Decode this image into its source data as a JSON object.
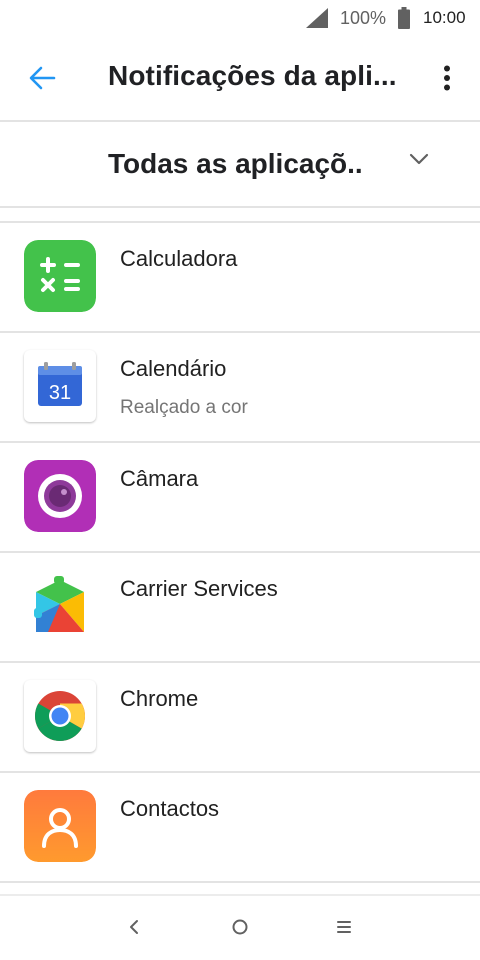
{
  "status_bar": {
    "battery_percent": "100%",
    "time": "10:00",
    "signal_icon": "cellular-signal-icon",
    "battery_icon": "battery-full-icon"
  },
  "app_bar": {
    "title": "Notificações da apli...",
    "back_icon": "arrow-back-icon",
    "menu_icon": "more-vert-icon",
    "accent_color": "#2196f3"
  },
  "filter": {
    "selected": "Todas as aplicaçõ..",
    "dropdown_icon": "chevron-down-icon"
  },
  "apps": [
    {
      "name": "Calculadora",
      "subtitle": "",
      "icon": "calculator-icon"
    },
    {
      "name": "Calendário",
      "subtitle": "Realçado a cor",
      "icon": "calendar-icon"
    },
    {
      "name": "Câmara",
      "subtitle": "",
      "icon": "camera-icon"
    },
    {
      "name": "Carrier Services",
      "subtitle": "",
      "icon": "carrier-services-icon"
    },
    {
      "name": "Chrome",
      "subtitle": "",
      "icon": "chrome-icon"
    },
    {
      "name": "Contactos",
      "subtitle": "",
      "icon": "contacts-icon"
    }
  ],
  "calendar_icon_day": "31",
  "nav_bar": {
    "back_icon": "nav-back-icon",
    "home_icon": "nav-home-icon",
    "recents_icon": "nav-menu-icon"
  }
}
